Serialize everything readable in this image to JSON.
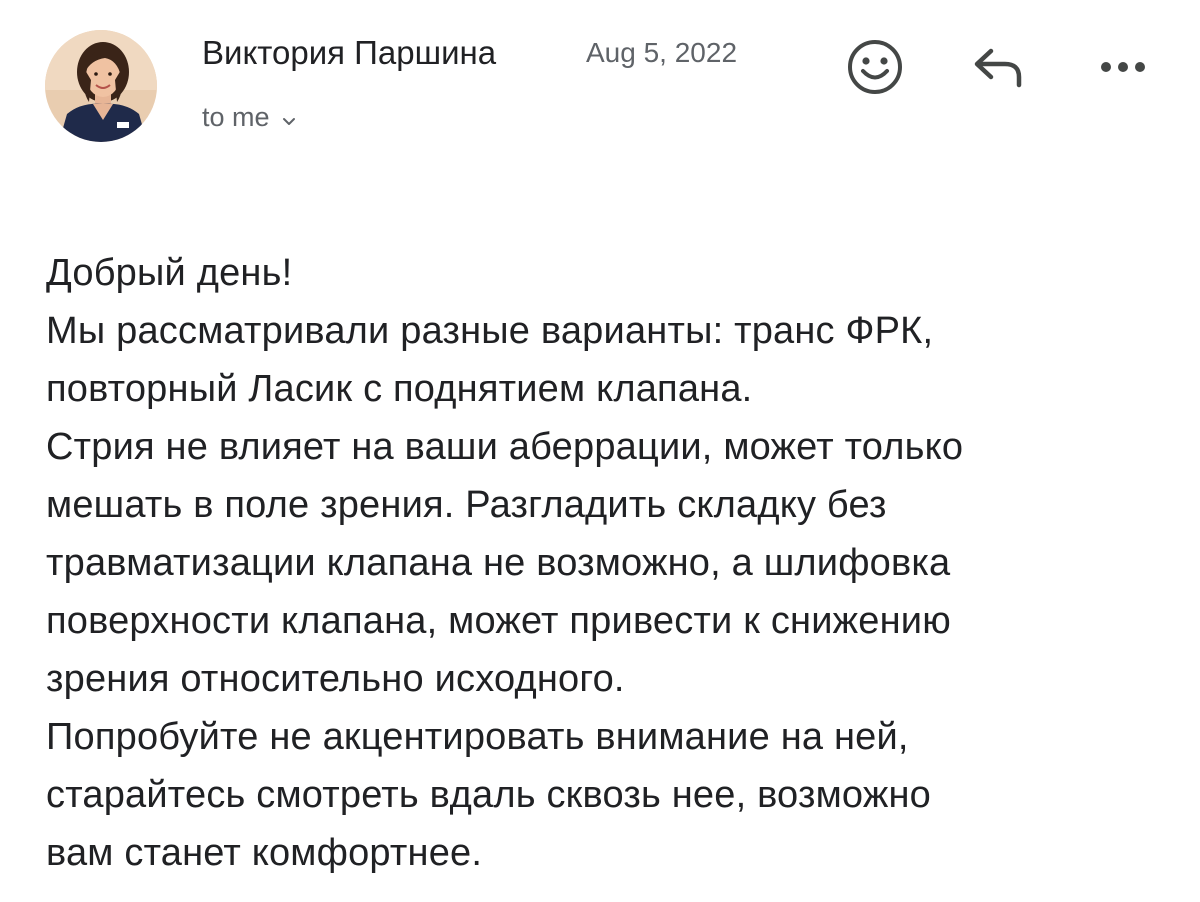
{
  "message": {
    "sender": {
      "name": "Виктория Паршина",
      "avatar_icon": "avatar-photo"
    },
    "date": "Aug 5, 2022",
    "recipient_label": "to me",
    "actions": {
      "emoji_icon": "smiley-icon",
      "reply_icon": "reply-arrow-icon",
      "more_icon": "more-dots-icon"
    },
    "body_lines": [
      "Добрый день!",
      "Мы рассматривали разные варианты: транс ФРК,",
      "повторный Ласик с поднятием клапана.",
      "Стрия не влияет на ваши аберрации, может только",
      "мешать в поле зрения. Разгладить складку без",
      "травматизации клапана не возможно, а шлифовка",
      "поверхности клапана, может привести к снижению",
      "зрения относительно исходного.",
      "Попробуйте не акцентировать внимание на ней,",
      "старайтесь смотреть вдаль сквозь нее, возможно",
      "вам станет комфортнее."
    ]
  },
  "colors": {
    "text_primary": "#202124",
    "text_secondary": "#5f6368",
    "icon": "#444746",
    "background": "#ffffff"
  }
}
